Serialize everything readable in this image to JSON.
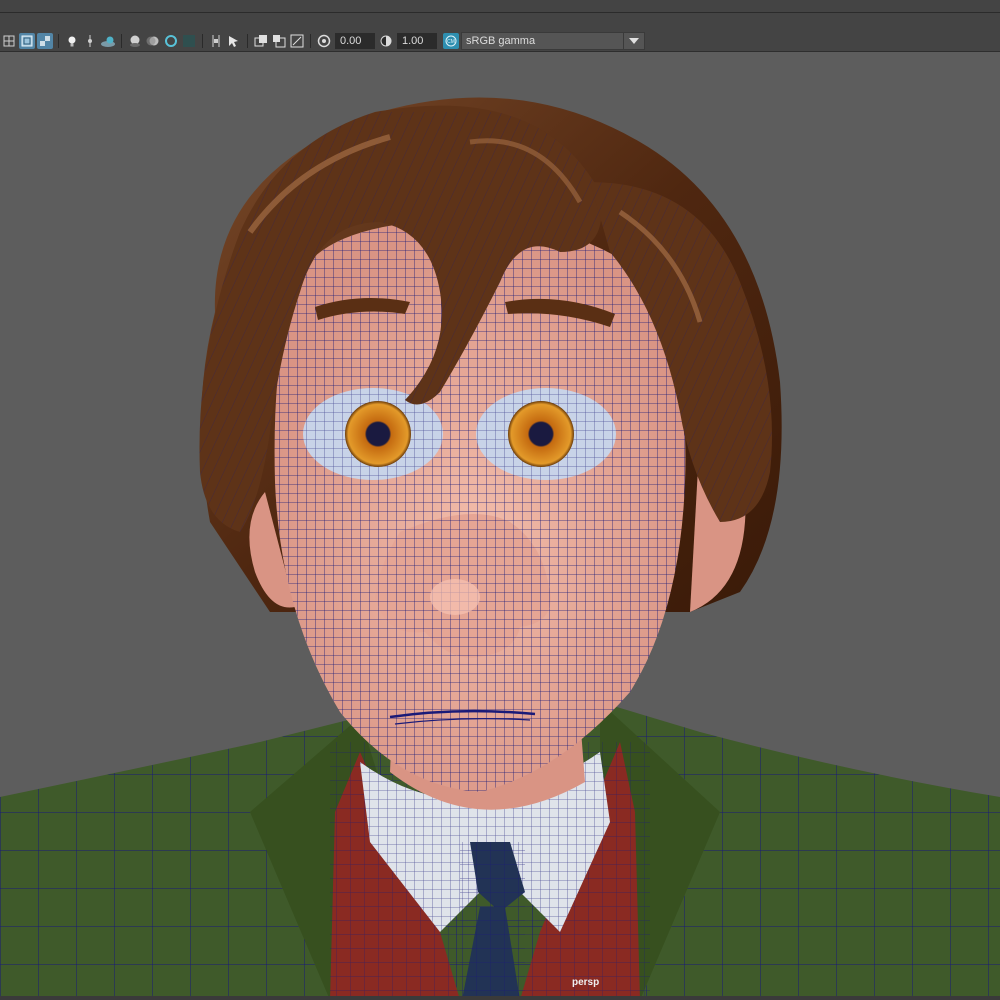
{
  "toolbar": {
    "exposure_value": "0.00",
    "gamma_value": "1.00",
    "color_management_badge": "CM",
    "view_transform": "sRGB gamma",
    "icons": [
      "wireframe-on-shaded-icon",
      "xray-icon",
      "xray-joints-icon",
      "lights-icon",
      "shadows-icon",
      "ambient-occlusion-icon",
      "screen-space-ao-icon",
      "motion-blur-icon",
      "anti-aliasing-icon",
      "depth-of-field-icon",
      "isolate-select-icon",
      "xray-active-icon",
      "camera-gate-icon",
      "resolution-gate-icon",
      "safe-action-icon",
      "exposure-icon",
      "gamma-icon"
    ]
  },
  "viewport": {
    "camera_label": "persp",
    "subject": "cartoon character head",
    "wireframe_color": "#1a1a78",
    "background_color": "#5d5d5d"
  },
  "colors": {
    "accent": "#5285a6",
    "skin": "#e8a896",
    "hair": "#5a2f14",
    "jacket": "#3f5a2a",
    "vest": "#8a2a22",
    "shirt": "#dfe3ea",
    "tie": "#223355",
    "iris": "#d98a1a"
  }
}
